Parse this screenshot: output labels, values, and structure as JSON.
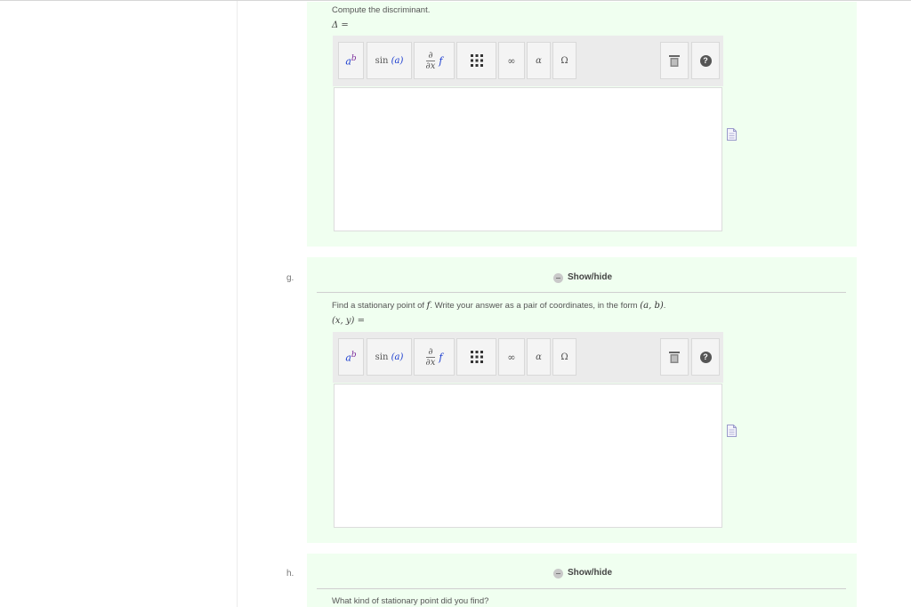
{
  "parts": [
    {
      "id": "f",
      "prompt": "Compute the discriminant.",
      "answer_label": "Δ =",
      "has_header": false
    },
    {
      "id": "g",
      "label": "g.",
      "showhide": "Show/hide",
      "prompt_before": "Find a stationary point of ",
      "prompt_var": "f",
      "prompt_mid": ". Write your answer as a pair of coordinates, in the form ",
      "prompt_form": "(a, b)",
      "prompt_end": ".",
      "answer_label": "(x, y) ="
    },
    {
      "id": "h",
      "label": "h.",
      "showhide": "Show/hide",
      "prompt": "What kind of stationary point did you find?"
    }
  ],
  "toolbar": {
    "power": {
      "base": "a",
      "exp": "b"
    },
    "sin_func": "sin",
    "sin_arg": "(a)",
    "deriv_num": "∂",
    "deriv_den": "∂x",
    "deriv_f": "f",
    "infinity": "∞",
    "alpha": "α",
    "omega": "Ω",
    "help": "?"
  },
  "icons": [
    "power-icon",
    "sin-icon",
    "derivative-icon",
    "matrix-icon",
    "infinity-icon",
    "alpha-icon",
    "omega-icon",
    "trash-icon",
    "help-icon",
    "document-icon"
  ],
  "colors": {
    "panel_bg": "#f0fff0",
    "toolbar_bg": "#ebebeb",
    "accent_blue": "#1a3ccf",
    "accent_purple": "#7a2a9a"
  }
}
